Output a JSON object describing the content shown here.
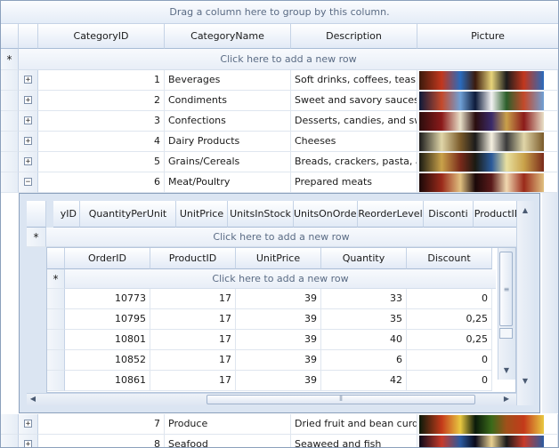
{
  "group_panel_text": "Drag a column here to group by this column.",
  "master": {
    "columns": [
      "CategoryID",
      "CategoryName",
      "Description",
      "Picture"
    ],
    "new_row_text": "Click here to add a new row",
    "rows": [
      {
        "id": "1",
        "name": "Beverages",
        "desc": "Soft drinks, coffees, teas,...",
        "expander": "+"
      },
      {
        "id": "2",
        "name": "Condiments",
        "desc": "Sweet and savory sauces,...",
        "expander": "+"
      },
      {
        "id": "3",
        "name": "Confections",
        "desc": "Desserts, candies, and sw...",
        "expander": "+"
      },
      {
        "id": "4",
        "name": "Dairy Products",
        "desc": "Cheeses",
        "expander": "+"
      },
      {
        "id": "5",
        "name": "Grains/Cereals",
        "desc": "Breads, crackers, pasta, a...",
        "expander": "+"
      },
      {
        "id": "6",
        "name": "Meat/Poultry",
        "desc": "Prepared meats",
        "expander": "−"
      }
    ],
    "rows_after": [
      {
        "id": "7",
        "name": "Produce",
        "desc": "Dried fruit and bean curd",
        "expander": "+"
      },
      {
        "id": "8",
        "name": "Seafood",
        "desc": "Seaweed and fish",
        "expander": "+"
      }
    ],
    "new_row_marker": "*"
  },
  "products_detail": {
    "columns": [
      "yID",
      "QuantityPerUnit",
      "UnitPrice",
      "UnitsInStock",
      "UnitsOnOrder",
      "ReorderLevel",
      "Disconti",
      "ProductID"
    ],
    "new_row_text": "Click here to add a new row",
    "new_row_marker": "*"
  },
  "orders_detail": {
    "columns": [
      "OrderID",
      "ProductID",
      "UnitPrice",
      "Quantity",
      "Discount"
    ],
    "new_row_text": "Click here to add a new row",
    "new_row_marker": "*",
    "rows": [
      [
        "10773",
        "17",
        "39",
        "33",
        "0"
      ],
      [
        "10795",
        "17",
        "39",
        "35",
        "0,25"
      ],
      [
        "10801",
        "17",
        "39",
        "40",
        "0,25"
      ],
      [
        "10852",
        "17",
        "39",
        "6",
        "0"
      ],
      [
        "10861",
        "17",
        "39",
        "42",
        "0"
      ]
    ]
  },
  "icons": {
    "expand": "plus-box-icon",
    "collapse": "minus-box-icon",
    "scroll_up": "arrow-up-icon",
    "scroll_down": "arrow-down-icon",
    "scroll_left": "arrow-left-icon",
    "scroll_right": "arrow-right-icon"
  },
  "colors": {
    "header_gradient_top": "#ffffff",
    "header_gradient_bottom": "#e2eaf6",
    "border": "#8ba0bc",
    "detail_background": "#dbe5f2"
  }
}
